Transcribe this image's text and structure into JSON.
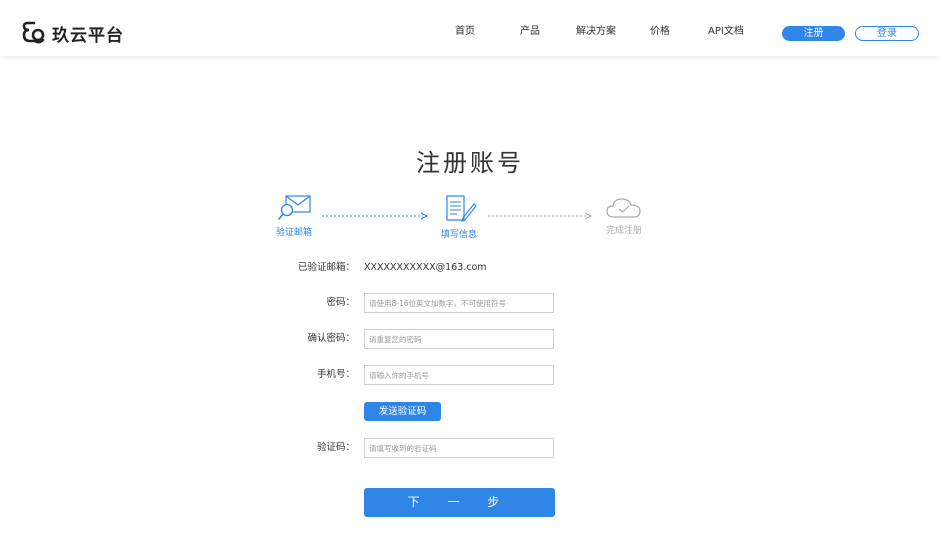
{
  "header": {
    "logo_text": "玖云平台",
    "nav": [
      "首页",
      "产品",
      "解决方案",
      "价格",
      "API文档"
    ],
    "register_label": "注册",
    "login_label": "登录"
  },
  "title": "注册账号",
  "steps": [
    {
      "label": "验证邮箱",
      "state": "done"
    },
    {
      "label": "填写信息",
      "state": "active"
    },
    {
      "label": "完成注册",
      "state": "pending"
    }
  ],
  "form": {
    "verified_email_label": "已验证邮箱：",
    "verified_email_value": "XXXXXXXXXXX@163.com",
    "password_label": "密码：",
    "password_placeholder": "请使用8-16位英文加数字，不可使用符号",
    "confirm_label": "确认密码：",
    "confirm_placeholder": "请重复您的密码",
    "phone_label": "手机号：",
    "phone_placeholder": "请输入你的手机号",
    "send_code_label": "发送验证码",
    "code_label": "验证码：",
    "code_placeholder": "请填写收到的验证码",
    "next_label": "下 一 步"
  },
  "colors": {
    "accent": "#2f86e6",
    "pending": "#aaaaaa"
  }
}
